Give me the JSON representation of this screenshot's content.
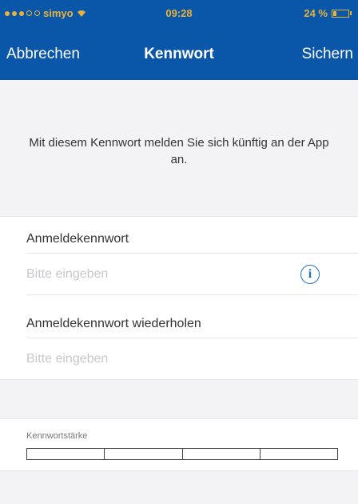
{
  "status_bar": {
    "carrier": "simyo",
    "time": "09:28",
    "battery": "24 %",
    "battery_level": 0.24,
    "signal_bars_filled": 3,
    "signal_bars_total": 5
  },
  "nav": {
    "cancel_label": "Abbrechen",
    "title": "Kennwort",
    "save_label": "Sichern"
  },
  "info_text": "Mit diesem Kennwort melden Sie sich künftig an der App an.",
  "password": {
    "label": "Anmeldekennwort",
    "placeholder": "Bitte eingeben",
    "value": ""
  },
  "password_repeat": {
    "label": "Anmeldekennwort wiederholen",
    "placeholder": "Bitte eingeben",
    "value": ""
  },
  "strength": {
    "label": "Kennwortstärke",
    "segments": 4,
    "filled": 0
  },
  "colors": {
    "nav_background": "#0a56a8",
    "status_text": "#e9b23a",
    "accent": "#1e6fd0",
    "page_background": "#f3f3f5"
  }
}
